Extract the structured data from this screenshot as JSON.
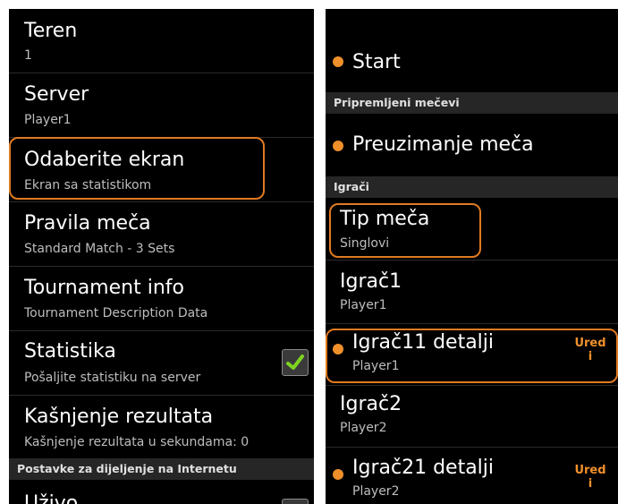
{
  "left_panel": {
    "items": [
      {
        "title": "Teren",
        "subtitle": "1"
      },
      {
        "title": "Server",
        "subtitle": "Player1"
      },
      {
        "title": "Odaberite ekran",
        "subtitle": "Ekran sa statistikom"
      },
      {
        "title": "Pravila meča",
        "subtitle": "Standard Match - 3 Sets"
      },
      {
        "title": "Tournament info",
        "subtitle": "Tournament Description Data"
      },
      {
        "title": "Statistika",
        "subtitle": "Pošaljite statistiku na server",
        "checked": true
      },
      {
        "title": "Kašnjenje rezultata",
        "subtitle": "Kašnjenje rezultata u sekundama: 0"
      }
    ],
    "section_header": "Postavke za dijeljenje na Internetu",
    "partial_item_title": "Uživo"
  },
  "right_panel": {
    "start_label": "Start",
    "section_prepared": "Pripremljeni mečevi",
    "download_label": "Preuzimanje meča",
    "section_players": "Igrači",
    "items": [
      {
        "title": "Tip meča",
        "subtitle": "Singlovi"
      },
      {
        "title": "Igrač1",
        "subtitle": "Player1"
      },
      {
        "title": "Igrač11 detalji",
        "subtitle": "Player1",
        "edit_label_line1": "Ured",
        "edit_label_line2": "i"
      },
      {
        "title": "Igrač2",
        "subtitle": "Player2"
      },
      {
        "title": "Igrač21 detalji",
        "subtitle": "Player2",
        "edit_label_line1": "Ured",
        "edit_label_line2": "i"
      }
    ]
  },
  "colors": {
    "accent": "#f0902b",
    "highlight_border": "#e07a21",
    "background": "#000000",
    "section_header_bg": "#262626",
    "check": "#7ed321"
  }
}
